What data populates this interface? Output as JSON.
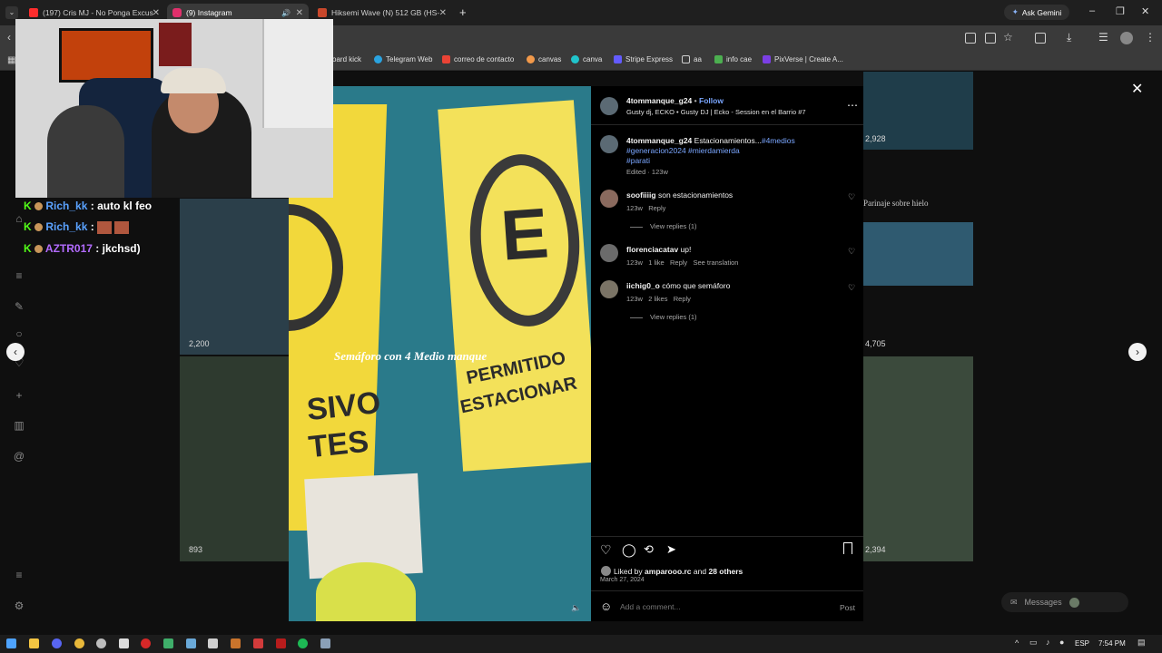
{
  "browser": {
    "tabs": [
      {
        "label": "(197) Cris MJ - No Ponga Excus",
        "favicon_color": "#ff2d2d"
      },
      {
        "label": "(9) Instagram",
        "favicon_color": "#e1306c"
      },
      {
        "label": "Hiksemi Wave (N) 512 GB (HS-",
        "favicon_color": "#c8472b"
      }
    ],
    "new_tab_icon": "plus-icon",
    "ask_gemini": "Ask Gemini",
    "bookmarks": [
      {
        "label": "oard kick",
        "color": "#53fc18"
      },
      {
        "label": "Telegram Web",
        "color": "#2aa3e0"
      },
      {
        "label": "correo de contacto",
        "color": "#ea4335"
      },
      {
        "label": "canvas",
        "color": "#f2994a"
      },
      {
        "label": "canva",
        "color": "#20c4cb"
      },
      {
        "label": "Stripe Express",
        "color": "#635bff"
      },
      {
        "label": "aa",
        "color": "#cfcfcf"
      },
      {
        "label": "info cae",
        "color": "#4caf50"
      },
      {
        "label": "PixVerse | Create A...",
        "color": "#7b3fe4"
      }
    ]
  },
  "stream": {
    "chat": [
      {
        "user": "Rich_kk",
        "sep": ":",
        "text": "auto kl feo",
        "user_color": "#5aa2ff"
      },
      {
        "user": "Rich_kk",
        "sep": ":",
        "text": "",
        "user_color": "#5aa2ff"
      },
      {
        "user": "AZTR017",
        "sep": ":",
        "text": "jkchsd)",
        "user_color": "#b36bff"
      }
    ]
  },
  "grid": {
    "counts": [
      "2,928",
      "2,200",
      "4,705",
      "893",
      "2,394"
    ],
    "caption_right": "Parinaje sobre hielo"
  },
  "post": {
    "username": "4tommanque_g24",
    "follow": "Follow",
    "bullet": "•",
    "audio": "Gusty dj, ECKO • Gusty DJ | Ecko - Session en el Barrio #7",
    "caption_user": "4tommanque_g24",
    "caption_text": "Estacionamientos...",
    "hashtags_line1": "#4medios",
    "hashtags_line2": "#generacion2024 #mierdamierda",
    "hashtags_line3": "#parati",
    "edited": "Edited · 123w",
    "overlay_text": "Semáforo con 4 Medio manque",
    "signs": {
      "e": "E",
      "permitido": "PERMITIDO",
      "estacionar": "ESTACIONAR",
      "sivo": "SIVO",
      "tes": "TES"
    },
    "comments": [
      {
        "user": "soofiiiig",
        "text": "son estacionamientos",
        "age": "123w",
        "likes": "",
        "reply": "Reply",
        "extra": "",
        "replies": "View replies (1)"
      },
      {
        "user": "florenciacatav",
        "text": "up!",
        "age": "123w",
        "likes": "1 like",
        "reply": "Reply",
        "extra": "See translation",
        "replies": ""
      },
      {
        "user": "iichig0_o",
        "text": "cómo que semáforo",
        "age": "123w",
        "likes": "2 likes",
        "reply": "Reply",
        "extra": "",
        "replies": "View replies (1)"
      }
    ],
    "liked_by_prefix": "Liked by",
    "liked_by_user": "amparooo.rc",
    "liked_by_and": "and",
    "liked_by_others": "28 others",
    "date": "March 27, 2024",
    "add_comment_placeholder": "Add a comment...",
    "post_button": "Post",
    "messages": "Messages"
  },
  "taskbar": {
    "lang": "ESP",
    "time": "7:54 PM"
  }
}
